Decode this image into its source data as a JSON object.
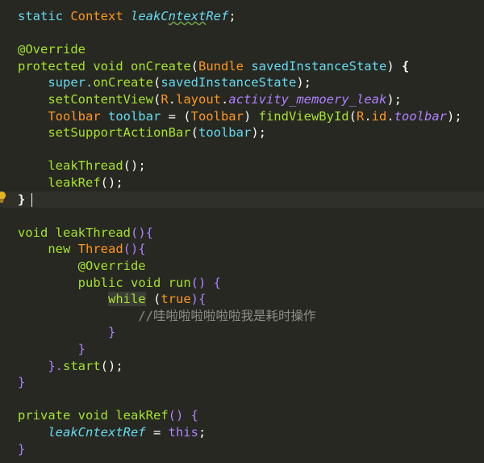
{
  "code": {
    "lines": [
      [
        {
          "t": "static ",
          "c": "kw"
        },
        {
          "t": "Context ",
          "c": "type"
        },
        {
          "t": "leakC",
          "c": "field"
        },
        {
          "t": "ntext",
          "c": "field squig"
        },
        {
          "t": "Ref",
          "c": "field"
        },
        {
          "t": ";",
          "c": "plain"
        }
      ],
      [],
      [
        {
          "t": "@Override",
          "c": "ann"
        }
      ],
      [
        {
          "t": "protected ",
          "c": "kwg"
        },
        {
          "t": "void ",
          "c": "kwg"
        },
        {
          "t": "onCreate",
          "c": "fn"
        },
        {
          "t": "(",
          "c": "plain"
        },
        {
          "t": "Bundle ",
          "c": "type"
        },
        {
          "t": "savedInstanceState",
          "c": "param"
        },
        {
          "t": ") ",
          "c": "plain"
        },
        {
          "t": "{",
          "c": "brh"
        }
      ],
      [
        {
          "t": "    super.",
          "c": "kw"
        },
        {
          "t": "onCreate",
          "c": "fn"
        },
        {
          "t": "(",
          "c": "plain"
        },
        {
          "t": "savedInstanceState",
          "c": "param"
        },
        {
          "t": ");",
          "c": "plain"
        }
      ],
      [
        {
          "t": "    setContentView",
          "c": "fn"
        },
        {
          "t": "(",
          "c": "plain"
        },
        {
          "t": "R",
          "c": "ok"
        },
        {
          "t": ".",
          "c": "plain"
        },
        {
          "t": "layout",
          "c": "ok"
        },
        {
          "t": ".",
          "c": "plain"
        },
        {
          "t": "activity_memoery_leak",
          "c": "ital"
        },
        {
          "t": ");",
          "c": "plain"
        }
      ],
      [
        {
          "t": "    Toolbar ",
          "c": "type"
        },
        {
          "t": "toolbar",
          "c": "param"
        },
        {
          "t": " = (",
          "c": "plain"
        },
        {
          "t": "Toolbar",
          "c": "type"
        },
        {
          "t": ") ",
          "c": "plain"
        },
        {
          "t": "findViewById",
          "c": "fn"
        },
        {
          "t": "(",
          "c": "plain"
        },
        {
          "t": "R",
          "c": "ok"
        },
        {
          "t": ".",
          "c": "plain"
        },
        {
          "t": "id",
          "c": "ok"
        },
        {
          "t": ".",
          "c": "plain"
        },
        {
          "t": "toolbar",
          "c": "ital"
        },
        {
          "t": ");",
          "c": "plain"
        }
      ],
      [
        {
          "t": "    setSupportActionBar",
          "c": "fn"
        },
        {
          "t": "(",
          "c": "plain"
        },
        {
          "t": "toolbar",
          "c": "param"
        },
        {
          "t": ");",
          "c": "plain"
        }
      ],
      [],
      [
        {
          "t": "    leakThread",
          "c": "fn"
        },
        {
          "t": "();",
          "c": "plain"
        }
      ],
      [
        {
          "t": "    leakRef",
          "c": "fn"
        },
        {
          "t": "();",
          "c": "plain"
        }
      ],
      [
        {
          "t": "}",
          "c": "brh"
        }
      ],
      [],
      [
        {
          "t": "void ",
          "c": "kwg"
        },
        {
          "t": "leakThread",
          "c": "fn"
        },
        {
          "t": "(){",
          "c": "purple"
        }
      ],
      [
        {
          "t": "    new ",
          "c": "kwg"
        },
        {
          "t": "Thread",
          "c": "type"
        },
        {
          "t": "(){",
          "c": "purple"
        }
      ],
      [
        {
          "t": "        @Override",
          "c": "ann"
        }
      ],
      [
        {
          "t": "        public ",
          "c": "kwg"
        },
        {
          "t": "void ",
          "c": "kwg"
        },
        {
          "t": "run",
          "c": "fn"
        },
        {
          "t": "() {",
          "c": "purple"
        }
      ],
      [
        {
          "t": "            ",
          "c": "plain"
        },
        {
          "t": "while",
          "c": "while"
        },
        {
          "t": " (",
          "c": "plain"
        },
        {
          "t": "true",
          "c": "ok"
        },
        {
          "t": "){",
          "c": "purple"
        }
      ],
      [
        {
          "t": "                //哇啦啦啦啦啦啦我是耗时操作",
          "c": "cmt"
        }
      ],
      [
        {
          "t": "            }",
          "c": "purple"
        }
      ],
      [
        {
          "t": "        }",
          "c": "purple"
        }
      ],
      [
        {
          "t": "    }.",
          "c": "purple"
        },
        {
          "t": "start",
          "c": "fn"
        },
        {
          "t": "();",
          "c": "plain"
        }
      ],
      [
        {
          "t": "}",
          "c": "purple"
        }
      ],
      [],
      [
        {
          "t": "private ",
          "c": "kwg"
        },
        {
          "t": "void ",
          "c": "kwg"
        },
        {
          "t": "leakRef",
          "c": "fn"
        },
        {
          "t": "() {",
          "c": "purple"
        }
      ],
      [
        {
          "t": "    leakCntextRef",
          "c": "field"
        },
        {
          "t": " = ",
          "c": "plain"
        },
        {
          "t": "this",
          "c": "this"
        },
        {
          "t": ";",
          "c": "plain"
        }
      ],
      [
        {
          "t": "}",
          "c": "purple"
        }
      ]
    ],
    "current_line": 11
  },
  "icons": {
    "gutter": "lightbulb-icon"
  },
  "colors": {
    "background": "#272822",
    "current_line": "#2f302a",
    "bulb": "#e6b422"
  }
}
